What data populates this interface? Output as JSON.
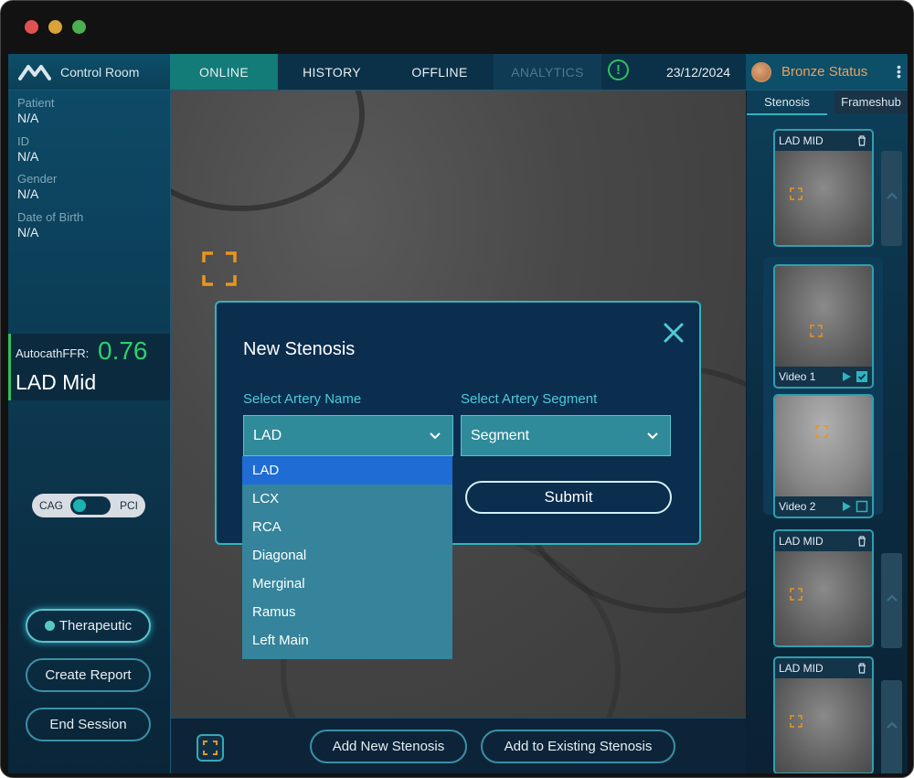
{
  "window": {
    "traffic_lights": [
      "#e05252",
      "#d9a338",
      "#4caf50"
    ]
  },
  "nav": {
    "brand": "Control Room",
    "tabs": [
      {
        "label": "ONLINE"
      },
      {
        "label": "HISTORY"
      },
      {
        "label": "OFFLINE"
      },
      {
        "label": "ANALYTICS"
      }
    ],
    "alert_symbol": "!",
    "date": "23/12/2024",
    "status_label": "Bronze Status"
  },
  "patient": {
    "fields": [
      {
        "label": "Patient",
        "value": "N/A"
      },
      {
        "label": "ID",
        "value": "N/A"
      },
      {
        "label": "Gender",
        "value": "N/A"
      },
      {
        "label": "Date of Birth",
        "value": "N/A"
      }
    ]
  },
  "ffr": {
    "label": "AutocathFFR:",
    "value": "0.76",
    "artery": "LAD Mid"
  },
  "mode_toggle": {
    "left": "CAG",
    "right": "PCI"
  },
  "actions": {
    "therapeutic": "Therapeutic",
    "create_report": "Create Report",
    "end_session": "End Session"
  },
  "bottom": {
    "add_new": "Add New Stenosis",
    "add_existing": "Add to Existing Stenosis"
  },
  "modal": {
    "title": "New Stenosis",
    "artery_label": "Select Artery Name",
    "segment_label": "Select Artery Segment",
    "artery_value": "LAD",
    "segment_value": "Segment",
    "submit": "Submit",
    "options": [
      "LAD",
      "LCX",
      "RCA",
      "Diagonal",
      "Merginal",
      "Ramus",
      "Left Main"
    ],
    "selected_option": "LAD"
  },
  "right_panel": {
    "tabs": [
      "Stenosis",
      "Frameshub"
    ],
    "thumbs": [
      {
        "title": "LAD MID"
      },
      {
        "caption": "Video 1",
        "checked": true
      },
      {
        "caption": "Video 2",
        "checked": false
      },
      {
        "title": "LAD MID"
      },
      {
        "title": "LAD MID"
      }
    ]
  },
  "colors": {
    "accent": "#2fb5bd",
    "ffr_good": "#2fd06a",
    "status_bronze": "#e8a15d",
    "selected_option": "#1f6cd4"
  }
}
